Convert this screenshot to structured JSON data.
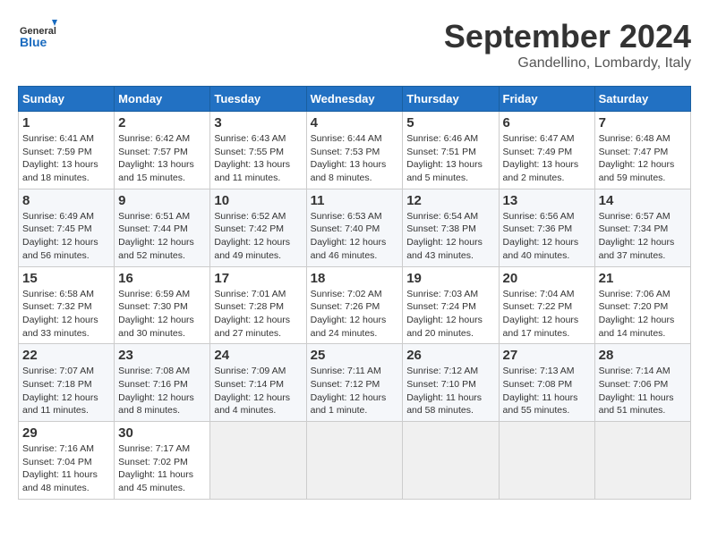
{
  "logo": {
    "general": "General",
    "blue": "Blue"
  },
  "title": "September 2024",
  "location": "Gandellino, Lombardy, Italy",
  "headers": [
    "Sunday",
    "Monday",
    "Tuesday",
    "Wednesday",
    "Thursday",
    "Friday",
    "Saturday"
  ],
  "weeks": [
    [
      {
        "day": "1",
        "sunrise": "6:41 AM",
        "sunset": "7:59 PM",
        "daylight": "13 hours and 18 minutes."
      },
      {
        "day": "2",
        "sunrise": "6:42 AM",
        "sunset": "7:57 PM",
        "daylight": "13 hours and 15 minutes."
      },
      {
        "day": "3",
        "sunrise": "6:43 AM",
        "sunset": "7:55 PM",
        "daylight": "13 hours and 11 minutes."
      },
      {
        "day": "4",
        "sunrise": "6:44 AM",
        "sunset": "7:53 PM",
        "daylight": "13 hours and 8 minutes."
      },
      {
        "day": "5",
        "sunrise": "6:46 AM",
        "sunset": "7:51 PM",
        "daylight": "13 hours and 5 minutes."
      },
      {
        "day": "6",
        "sunrise": "6:47 AM",
        "sunset": "7:49 PM",
        "daylight": "13 hours and 2 minutes."
      },
      {
        "day": "7",
        "sunrise": "6:48 AM",
        "sunset": "7:47 PM",
        "daylight": "12 hours and 59 minutes."
      }
    ],
    [
      {
        "day": "8",
        "sunrise": "6:49 AM",
        "sunset": "7:45 PM",
        "daylight": "12 hours and 56 minutes."
      },
      {
        "day": "9",
        "sunrise": "6:51 AM",
        "sunset": "7:44 PM",
        "daylight": "12 hours and 52 minutes."
      },
      {
        "day": "10",
        "sunrise": "6:52 AM",
        "sunset": "7:42 PM",
        "daylight": "12 hours and 49 minutes."
      },
      {
        "day": "11",
        "sunrise": "6:53 AM",
        "sunset": "7:40 PM",
        "daylight": "12 hours and 46 minutes."
      },
      {
        "day": "12",
        "sunrise": "6:54 AM",
        "sunset": "7:38 PM",
        "daylight": "12 hours and 43 minutes."
      },
      {
        "day": "13",
        "sunrise": "6:56 AM",
        "sunset": "7:36 PM",
        "daylight": "12 hours and 40 minutes."
      },
      {
        "day": "14",
        "sunrise": "6:57 AM",
        "sunset": "7:34 PM",
        "daylight": "12 hours and 37 minutes."
      }
    ],
    [
      {
        "day": "15",
        "sunrise": "6:58 AM",
        "sunset": "7:32 PM",
        "daylight": "12 hours and 33 minutes."
      },
      {
        "day": "16",
        "sunrise": "6:59 AM",
        "sunset": "7:30 PM",
        "daylight": "12 hours and 30 minutes."
      },
      {
        "day": "17",
        "sunrise": "7:01 AM",
        "sunset": "7:28 PM",
        "daylight": "12 hours and 27 minutes."
      },
      {
        "day": "18",
        "sunrise": "7:02 AM",
        "sunset": "7:26 PM",
        "daylight": "12 hours and 24 minutes."
      },
      {
        "day": "19",
        "sunrise": "7:03 AM",
        "sunset": "7:24 PM",
        "daylight": "12 hours and 20 minutes."
      },
      {
        "day": "20",
        "sunrise": "7:04 AM",
        "sunset": "7:22 PM",
        "daylight": "12 hours and 17 minutes."
      },
      {
        "day": "21",
        "sunrise": "7:06 AM",
        "sunset": "7:20 PM",
        "daylight": "12 hours and 14 minutes."
      }
    ],
    [
      {
        "day": "22",
        "sunrise": "7:07 AM",
        "sunset": "7:18 PM",
        "daylight": "12 hours and 11 minutes."
      },
      {
        "day": "23",
        "sunrise": "7:08 AM",
        "sunset": "7:16 PM",
        "daylight": "12 hours and 8 minutes."
      },
      {
        "day": "24",
        "sunrise": "7:09 AM",
        "sunset": "7:14 PM",
        "daylight": "12 hours and 4 minutes."
      },
      {
        "day": "25",
        "sunrise": "7:11 AM",
        "sunset": "7:12 PM",
        "daylight": "12 hours and 1 minute."
      },
      {
        "day": "26",
        "sunrise": "7:12 AM",
        "sunset": "7:10 PM",
        "daylight": "11 hours and 58 minutes."
      },
      {
        "day": "27",
        "sunrise": "7:13 AM",
        "sunset": "7:08 PM",
        "daylight": "11 hours and 55 minutes."
      },
      {
        "day": "28",
        "sunrise": "7:14 AM",
        "sunset": "7:06 PM",
        "daylight": "11 hours and 51 minutes."
      }
    ],
    [
      {
        "day": "29",
        "sunrise": "7:16 AM",
        "sunset": "7:04 PM",
        "daylight": "11 hours and 48 minutes."
      },
      {
        "day": "30",
        "sunrise": "7:17 AM",
        "sunset": "7:02 PM",
        "daylight": "11 hours and 45 minutes."
      },
      null,
      null,
      null,
      null,
      null
    ]
  ]
}
